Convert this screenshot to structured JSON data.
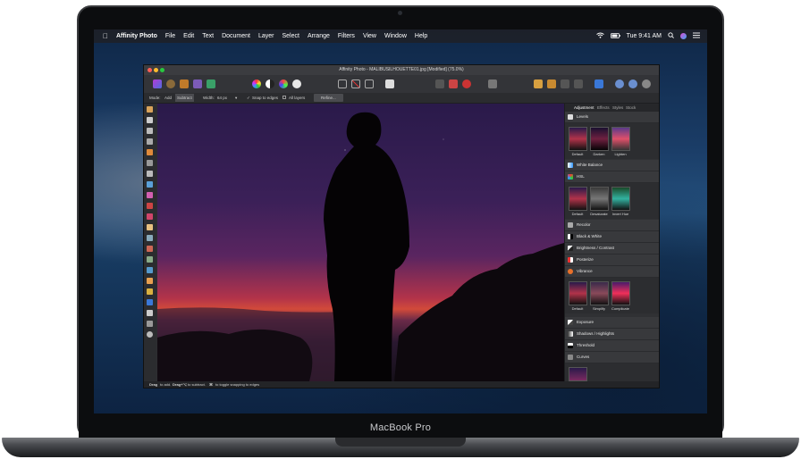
{
  "device": {
    "brand": "MacBook Pro"
  },
  "menubar": {
    "app_name": "Affinity Photo",
    "items": [
      "File",
      "Edit",
      "Text",
      "Document",
      "Layer",
      "Select",
      "Arrange",
      "Filters",
      "View",
      "Window",
      "Help"
    ],
    "clock": "Tue 9:41 AM"
  },
  "window": {
    "title": "Affinity Photo - MALIBUSILHOUETTE01.jpg [Modified] (75.0%)"
  },
  "context_toolbar": {
    "mode_label": "Mode:",
    "mode_add": "Add",
    "mode_subtract": "Subtract",
    "width_label": "Width:",
    "width_value": "64 px",
    "snap_label": "Snap to edges",
    "all_layers_label": "All layers",
    "refine_label": "Refine..."
  },
  "panel": {
    "tabs": [
      "Adjustment",
      "Effects",
      "Styles",
      "Stock"
    ],
    "sections": [
      {
        "label": "Levels",
        "presets": [
          "Default",
          "Darken",
          "Lighten"
        ]
      },
      {
        "label": "White Balance",
        "presets": []
      },
      {
        "label": "HSL",
        "presets": [
          "Default",
          "Desaturate",
          "Invert Hue"
        ]
      },
      {
        "label": "Recolor",
        "presets": []
      },
      {
        "label": "Black & White",
        "presets": []
      },
      {
        "label": "Brightness / Contrast",
        "presets": []
      },
      {
        "label": "Posterize",
        "presets": []
      },
      {
        "label": "Vibrance",
        "presets": [
          "Default",
          "Simplify",
          "Complicate"
        ]
      },
      {
        "label": "Exposure",
        "presets": []
      },
      {
        "label": "Shadows / Highlights",
        "presets": []
      },
      {
        "label": "Threshold",
        "presets": []
      },
      {
        "label": "Curves",
        "presets": []
      }
    ]
  },
  "status": {
    "drag_1": "Drag",
    "text_1": "to add.",
    "drag_2": "Drag+⌥",
    "text_2": "to subtract.",
    "key_3": "⌘",
    "text_3": "to toggle snapping to edges"
  },
  "colors": {
    "accent": "#3a78d8",
    "traffic_red": "#fe5f57",
    "traffic_yellow": "#febc2e",
    "traffic_green": "#28c840"
  }
}
